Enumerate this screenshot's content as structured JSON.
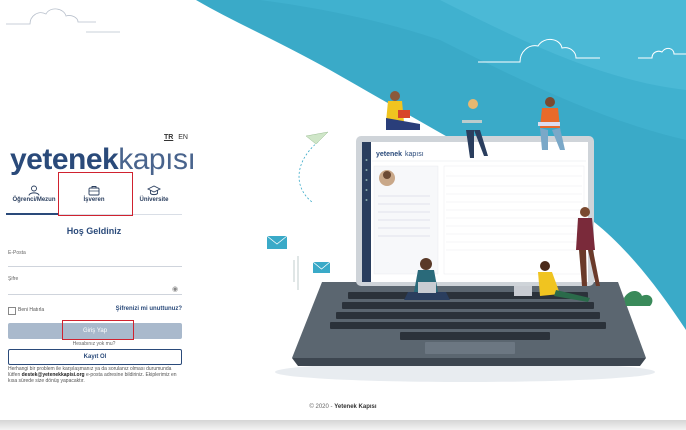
{
  "lang": {
    "tr": "TR",
    "en": "EN"
  },
  "logo": {
    "part1": "yetenek",
    "part2": "kapısı"
  },
  "tabs": [
    {
      "label": "Öğrenci/Mezun",
      "icon": "person-icon"
    },
    {
      "label": "İşveren",
      "icon": "briefcase-icon"
    },
    {
      "label": "Üniversite",
      "icon": "graduation-cap-icon"
    }
  ],
  "welcome": "Hoş Geldiniz",
  "form": {
    "email_label": "E-Posta",
    "password_label": "Şifre",
    "remember_label": "Beni Hatırla",
    "forgot_label": "Şifrenizi mi unuttunuz?",
    "login_button": "Giriş Yap",
    "no_account": "Hesabınız yok mu?",
    "register_button": "Kayıt Ol"
  },
  "help_text": {
    "before": "Herhangi bir problem ile karşılaşmanız ya da sorulanız olması durumunda lütfen ",
    "email": "destek@yetenekkapisi.org",
    "after": " e-posta adresine bildiriniz. Ekiplerimiz en kısa sürede size dönüş yapacaktır."
  },
  "footer": {
    "year": "© 2020 - ",
    "brand": "Yetenek Kapısı"
  },
  "colors": {
    "accent": "#2a4a7a",
    "teal": "#3aaac8",
    "highlight": "#d0222f"
  }
}
